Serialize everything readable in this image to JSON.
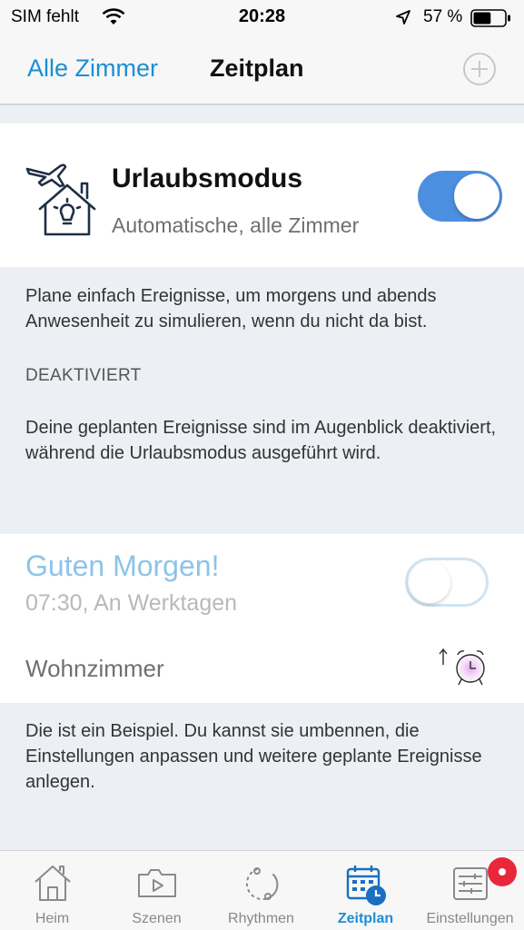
{
  "status_bar": {
    "carrier": "SIM fehlt",
    "time": "20:28",
    "battery_percent": "57 %",
    "battery_level": 0.57,
    "icons": [
      "wifi-icon",
      "location-arrow-icon",
      "battery-icon"
    ]
  },
  "nav": {
    "back_label": "Alle Zimmer",
    "title": "Zeitplan",
    "add_icon": "plus-circle-icon"
  },
  "vacation": {
    "title": "Urlaubsmodus",
    "subtitle": "Automatische, alle Zimmer",
    "enabled": true,
    "icon": "airplane-house-bulb-icon"
  },
  "vacation_info": {
    "description": "Plane einfach Ereignisse, um morgens und abends Anwesenheit zu simulieren, wenn du nicht da bist.",
    "status_label": "DEAKTIVIERT",
    "status_description": "Deine geplanten Ereignisse sind im Augenblick deaktiviert, während die Urlaubsmodus ausgeführt wird."
  },
  "schedule_item": {
    "title": "Guten Morgen!",
    "time": "07:30, An Werktagen",
    "room": "Wohnzimmer",
    "enabled": false,
    "icon": "alarm-clock-icon"
  },
  "example_info": {
    "description": "Die ist ein Beispiel. Du kannst sie umbennen, die Einstellungen anpassen und weitere geplante Ereignisse anlegen."
  },
  "tabs": [
    {
      "label": "Heim",
      "icon": "home-icon",
      "active": false
    },
    {
      "label": "Szenen",
      "icon": "scenes-icon",
      "active": false
    },
    {
      "label": "Rhythmen",
      "icon": "rhythms-icon",
      "active": false
    },
    {
      "label": "Zeitplan",
      "icon": "calendar-clock-icon",
      "active": true
    },
    {
      "label": "Einstellungen",
      "icon": "settings-icon",
      "active": false
    }
  ],
  "colors": {
    "accent": "#1a8fd6",
    "toggle_on": "#4c8fe0",
    "badge": "#e8283a",
    "inactive_title": "#8cc4e8"
  }
}
